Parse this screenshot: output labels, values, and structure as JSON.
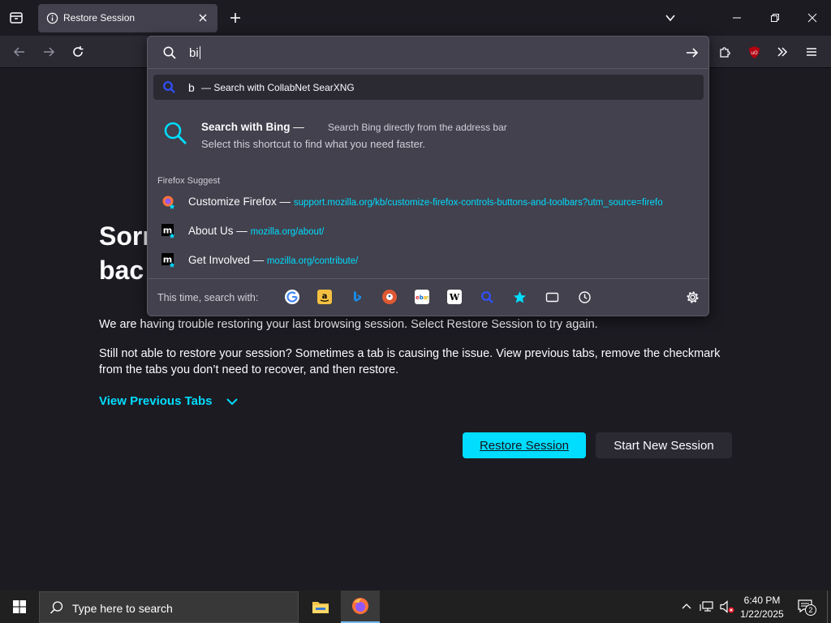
{
  "tabstrip": {
    "tab_title": "Restore Session"
  },
  "urlbar": {
    "value": "bi",
    "heuristic": {
      "keyword": "b",
      "hint": "— Search with CollabNet SearXNG"
    },
    "tip": {
      "title": "Search with Bing",
      "title_dash": "—",
      "description": "Search Bing directly from the address bar",
      "body": "Select this shortcut to find what you need faster."
    },
    "group_label": "Firefox Suggest",
    "suggestions": [
      {
        "title": "Customize Firefox",
        "sep": "—",
        "url": "support.mozilla.org/kb/customize-firefox-controls-buttons-and-toolbars?utm_source=firefo"
      },
      {
        "title": "About Us",
        "sep": "—",
        "url": "mozilla.org/about/"
      },
      {
        "title": "Get Involved",
        "sep": "—",
        "url": "mozilla.org/contribute/"
      }
    ],
    "one_off_label": "This time, search with:",
    "engines": [
      "google",
      "amazon",
      "bing",
      "duckduckgo",
      "ebay",
      "wikipedia",
      "searxng",
      "bookmarks",
      "tabs",
      "history"
    ]
  },
  "page": {
    "heading_line1": "Sorr",
    "heading_line2": "bac",
    "para1": "We are having trouble restoring your last browsing session. Select Restore Session to try again.",
    "para2": "Still not able to restore your session? Sometimes a tab is causing the issue. View previous tabs, remove the checkmark from the tabs you don’t need to recover, and then restore.",
    "view_previous": "View Previous Tabs",
    "restore_btn": "Restore Session",
    "new_session_btn": "Start New Session"
  },
  "taskbar": {
    "search_placeholder": "Type here to search",
    "time": "6:40 PM",
    "date": "1/22/2025",
    "notifications": "2"
  },
  "colors": {
    "accent": "#00ddff",
    "background": "#1c1b22",
    "panel": "#42414d"
  }
}
